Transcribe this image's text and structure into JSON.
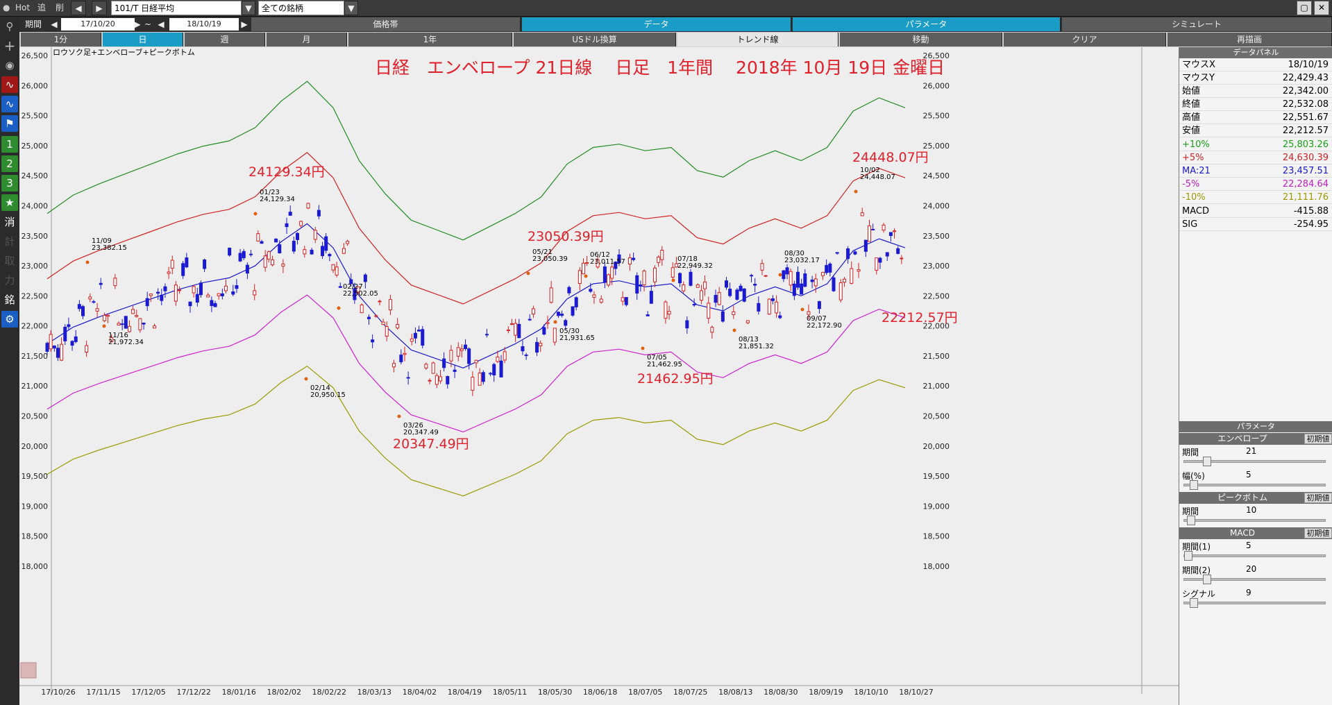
{
  "topbar": {
    "hot": "Hot",
    "tsui": "追",
    "sakujo": "削",
    "symbol": "101/T 日経平均",
    "universe": "全ての銘柄"
  },
  "period": {
    "label": "期間",
    "start": "17/10/20",
    "tilde": "~",
    "end": "18/10/19"
  },
  "sections": [
    "価格帯",
    "データ",
    "パラメータ",
    "シミュレート"
  ],
  "timeframes": [
    "1分",
    "日",
    "週",
    "月",
    "1年",
    "USドル換算",
    "トレンド線",
    "移動",
    "クリア",
    "再描画"
  ],
  "lefttools": [
    "1",
    "2",
    "3",
    "★",
    "消",
    "計",
    "取",
    "力",
    "銘"
  ],
  "chart": {
    "indicator_label": "ロウソク足+エンベローブ+ピークボトム",
    "title": "日経　エンベロープ 21日線　 日足　1年間　 2018年 10月 19日 金曜日",
    "annotations": [
      "24129.34円",
      "23050.39円",
      "24448.07円",
      "20347.49円",
      "21462.95円",
      "22212.57円"
    ],
    "peaks": [
      {
        "date": "11/09",
        "value": "23,382.15"
      },
      {
        "date": "11/16",
        "value": "21,972.34"
      },
      {
        "date": "01/23",
        "value": "24,129.34"
      },
      {
        "date": "02/14",
        "value": "20,950.15"
      },
      {
        "date": "02/27",
        "value": "22,502.05"
      },
      {
        "date": "03/26",
        "value": "20,347.49"
      },
      {
        "date": "05/21",
        "value": "23,050.39"
      },
      {
        "date": "05/30",
        "value": "21,931.65"
      },
      {
        "date": "06/12",
        "value": "23,011.57"
      },
      {
        "date": "07/05",
        "value": "21,462.95"
      },
      {
        "date": "07/18",
        "value": "22,949.32"
      },
      {
        "date": "08/13",
        "value": "21,851.32"
      },
      {
        "date": "08/30",
        "value": "23,032.17"
      },
      {
        "date": "09/07",
        "value": "22,172.90"
      },
      {
        "date": "10/02",
        "value": "24,448.07"
      }
    ]
  },
  "chart_data": {
    "type": "candlestick",
    "title": "日経　エンベロープ 21日線　 日足　1年間　 2018年 10月 19日 金曜日",
    "y_ticks": [
      "26,500",
      "26,000",
      "25,500",
      "25,000",
      "24,500",
      "24,000",
      "23,500",
      "23,000",
      "22,500",
      "22,000",
      "21,500",
      "21,000",
      "20,500",
      "20,000",
      "19,500",
      "19,000",
      "18,500",
      "18,000"
    ],
    "ylim": [
      18000,
      26800
    ],
    "x_ticks": [
      "17/10/26",
      "17/11/15",
      "17/12/05",
      "17/12/22",
      "18/01/16",
      "18/02/02",
      "18/02/22",
      "18/03/13",
      "18/04/02",
      "18/04/19",
      "18/05/11",
      "18/05/30",
      "18/06/18",
      "18/07/05",
      "18/07/25",
      "18/08/13",
      "18/08/30",
      "18/09/19",
      "18/10/10",
      "18/10/27"
    ],
    "ma21": [
      [
        0,
        21700
      ],
      [
        1,
        21980
      ],
      [
        2,
        22150
      ],
      [
        3,
        22300
      ],
      [
        4,
        22450
      ],
      [
        5,
        22600
      ],
      [
        6,
        22720
      ],
      [
        7,
        22800
      ],
      [
        8,
        23000
      ],
      [
        9,
        23400
      ],
      [
        10,
        23700
      ],
      [
        11,
        23300
      ],
      [
        12,
        22500
      ],
      [
        13,
        22000
      ],
      [
        14,
        21600
      ],
      [
        15,
        21450
      ],
      [
        16,
        21300
      ],
      [
        17,
        21500
      ],
      [
        18,
        21700
      ],
      [
        19,
        21950
      ],
      [
        20,
        22450
      ],
      [
        21,
        22700
      ],
      [
        22,
        22750
      ],
      [
        23,
        22650
      ],
      [
        24,
        22700
      ],
      [
        25,
        22350
      ],
      [
        26,
        22250
      ],
      [
        27,
        22500
      ],
      [
        28,
        22650
      ],
      [
        29,
        22500
      ],
      [
        30,
        22700
      ],
      [
        31,
        23250
      ],
      [
        32,
        23450
      ],
      [
        33,
        23300
      ]
    ],
    "series": [
      {
        "name": "+10%",
        "color": "#228B22"
      },
      {
        "name": "+5%",
        "color": "#d42020"
      },
      {
        "name": "MA:21",
        "color": "#1a1ad0"
      },
      {
        "name": "-5%",
        "color": "#d020d0"
      },
      {
        "name": "-10%",
        "color": "#9a9a00"
      }
    ]
  },
  "datapanel": {
    "title": "データパネル",
    "rows": [
      {
        "label": "マウスX",
        "value": "18/10/19",
        "color": "#000000"
      },
      {
        "label": "マウスY",
        "value": "22,429.43",
        "color": "#000000"
      },
      {
        "label": "始値",
        "value": "22,342.00",
        "color": "#000000"
      },
      {
        "label": "終値",
        "value": "22,532.08",
        "color": "#000000"
      },
      {
        "label": "高値",
        "value": "22,551.67",
        "color": "#000000"
      },
      {
        "label": "安値",
        "value": "22,212.57",
        "color": "#000000"
      },
      {
        "label": "+10%",
        "value": "25,803.26",
        "color": "#18a018"
      },
      {
        "label": "+5%",
        "value": "24,630.39",
        "color": "#d42020"
      },
      {
        "label": "MA:21",
        "value": "23,457.51",
        "color": "#1a1ad0"
      },
      {
        "label": "-5%",
        "value": "22,284.64",
        "color": "#c020c0"
      },
      {
        "label": "-10%",
        "value": "21,111.76",
        "color": "#9a9a00"
      },
      {
        "label": "MACD",
        "value": "-415.88",
        "color": "#000000"
      },
      {
        "label": "SIG",
        "value": "-254.95",
        "color": "#000000"
      }
    ]
  },
  "params": {
    "title": "パラメータ",
    "reset": "初期値",
    "sections": [
      {
        "name": "エンベロープ",
        "rows": [
          {
            "label": "期間",
            "value": "21",
            "pos": 0.14
          },
          {
            "label": "幅(%)",
            "value": "5",
            "pos": 0.04
          }
        ]
      },
      {
        "name": "ピークボトム",
        "rows": [
          {
            "label": "期間",
            "value": "10",
            "pos": 0.02
          }
        ]
      },
      {
        "name": "MACD",
        "rows": [
          {
            "label": "期間(1)",
            "value": "5",
            "pos": 0.0
          },
          {
            "label": "期間(2)",
            "value": "20",
            "pos": 0.14
          },
          {
            "label": "シグナル",
            "value": "9",
            "pos": 0.04
          }
        ]
      }
    ]
  }
}
